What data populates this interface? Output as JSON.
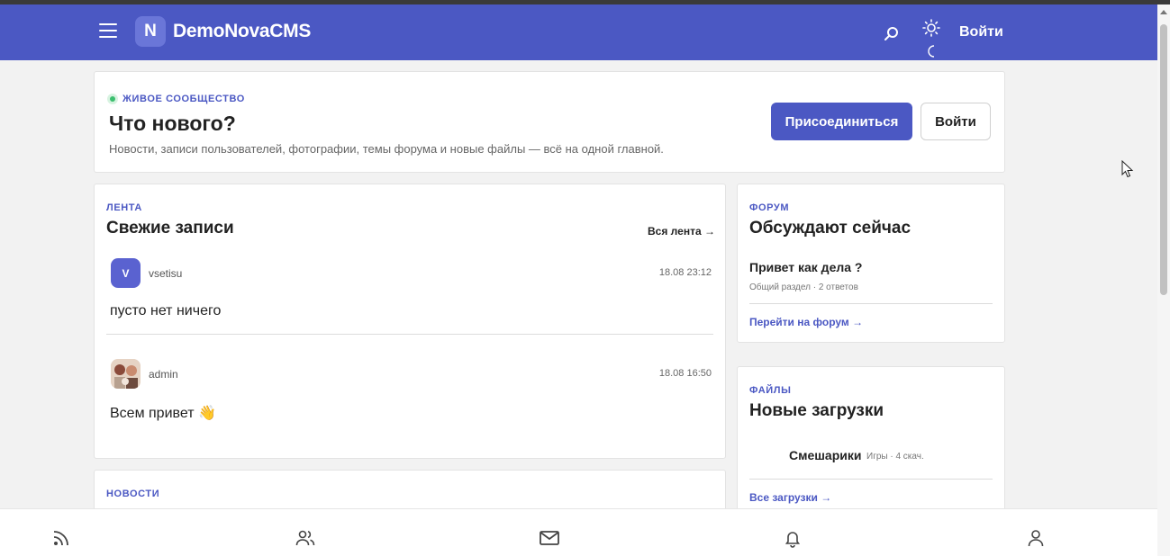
{
  "header": {
    "logo_letter": "N",
    "brand": "DemoNovaCMS",
    "login_label": "Войти",
    "icons": [
      "menu-icon",
      "search-icon",
      "sun-icon",
      "moon-icon"
    ]
  },
  "hero": {
    "badge": "ЖИВОЕ СООБЩЕСТВО",
    "title": "Что нового?",
    "subtitle": "Новости, записи пользователей, фотографии, темы форума и новые файлы — всё на одной главной.",
    "join_label": "Присоединиться",
    "login_label": "Войти"
  },
  "feed": {
    "label": "ЛЕНТА",
    "title": "Свежие записи",
    "all_link": "Вся лента →",
    "posts": [
      {
        "avatar_letter": "V",
        "author": "vsetisu",
        "time": "18.08 23:12",
        "text": "пусто нет ничего"
      },
      {
        "avatar_letter": "",
        "author": "admin",
        "time": "18.08 16:50",
        "text": "Всем привет 👋"
      }
    ]
  },
  "news": {
    "label": "НОВОСТИ"
  },
  "forum": {
    "label": "ФОРУМ",
    "title": "Обсуждают сейчас",
    "topic_title": "Привет как дела ?",
    "topic_meta": "Общий раздел · 2 ответов",
    "link": "Перейти на форум →"
  },
  "files": {
    "label": "ФАЙЛЫ",
    "title": "Новые загрузки",
    "file_name": "Смешарики",
    "file_meta": "Игры · 4 скач.",
    "link": "Все загрузки →"
  },
  "bottom_nav": [
    "feed-icon",
    "users-icon",
    "mail-icon",
    "bell-icon",
    "profile-icon"
  ],
  "colors": {
    "accent": "#4b58c3",
    "live_dot": "#3cbf6f",
    "page_bg": "#f2f2f2"
  }
}
